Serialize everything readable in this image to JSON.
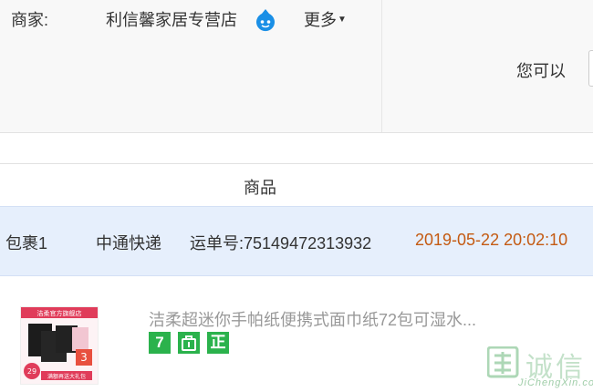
{
  "merchant": {
    "label": "商家:",
    "name": "利信馨家居专营店",
    "more": "更多"
  },
  "actions": {
    "hint": "您可以"
  },
  "table": {
    "column_product": "商品"
  },
  "package": {
    "name": "包裹1",
    "carrier": "中通快递",
    "tracking_label": "运单号:",
    "tracking_number": "75149472313932",
    "time": "2019-05-22 20:02:10"
  },
  "product": {
    "title": "洁柔超迷你手帕纸便携式面巾纸72包可湿水...",
    "badges": [
      "7",
      "正"
    ],
    "image_text": {
      "banner": "洁柔官方旗舰店",
      "price": "29",
      "count": "3",
      "footer": "满额再送大礼包"
    }
  },
  "watermark": {
    "cn": "诚信",
    "en": "JiChengXin.com"
  },
  "colors": {
    "package_bar": "#e6effc",
    "time_text": "#c45a12",
    "badge_green": "#2bb24c",
    "chat_blue": "#1a8fe6"
  }
}
